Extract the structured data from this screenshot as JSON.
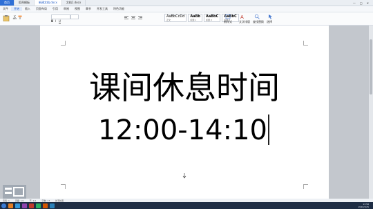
{
  "tabs": [
    {
      "label": "首页",
      "state": "home"
    },
    {
      "label": "稻壳模板",
      "state": "normal"
    },
    {
      "label": "新建文档.docx",
      "state": "active"
    },
    {
      "label": "文档1.docx",
      "state": "normal"
    }
  ],
  "menus": [
    "文件",
    "开始",
    "插入",
    "页面布局",
    "引用",
    "审阅",
    "视图",
    "章节",
    "开发工具",
    "特色功能"
  ],
  "active_menu": "开始",
  "ribbon": {
    "styles": [
      {
        "sample": "AaBbCcDd",
        "caption": "正文"
      },
      {
        "sample": "AaBb",
        "caption": "标题 1"
      },
      {
        "sample": "AaBbC",
        "caption": "标题 2"
      },
      {
        "sample": "AaBbC",
        "caption": "标题 3"
      }
    ],
    "tools": [
      "新样式",
      "文字排版",
      "查找替换",
      "选择"
    ]
  },
  "document": {
    "line1": "课间休息时间",
    "line2": "12:00-14:10"
  },
  "statusbar": {
    "page": "页码: 1",
    "pages": "页面: 1/1",
    "section": "节: 1/1",
    "words": "字数: 17",
    "spell": "拼写检查"
  },
  "taskbar": {
    "time": "13:58",
    "date": "2020/3/25"
  },
  "colors": {
    "accent": "#2f6fd6",
    "taskbar": "#1e2d44"
  }
}
